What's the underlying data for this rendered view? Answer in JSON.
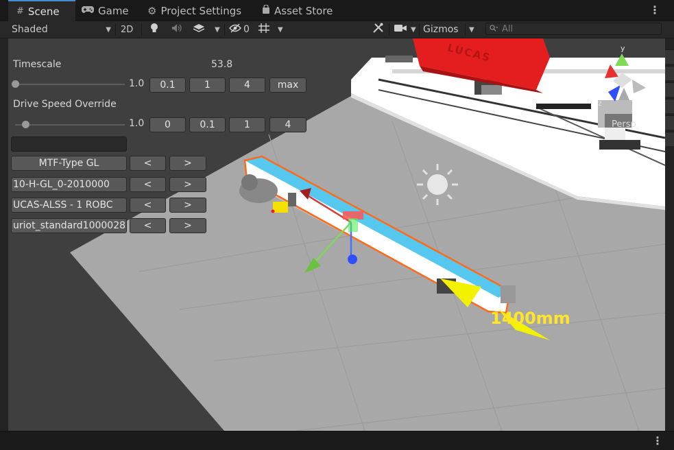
{
  "tabs": [
    {
      "icon": "#",
      "label": "Scene"
    },
    {
      "icon": "🎮",
      "label": "Game"
    },
    {
      "icon": "⚙",
      "label": "Project Settings"
    },
    {
      "icon": "🔒",
      "label": "Asset Store"
    }
  ],
  "toolbar": {
    "shading_mode": "Shaded",
    "mode_2d": "2D",
    "hidden_count": "0",
    "gizmos_label": "Gizmos",
    "search_placeholder": "All"
  },
  "overlay": {
    "timescale_label": "Timescale",
    "timescale_value": "53.8",
    "timescale_slider_value": "1.0",
    "timescale_presets": [
      "0.1",
      "1",
      "4",
      "max"
    ],
    "drive_speed_label": "Drive Speed Override",
    "drive_speed_slider_value": "1.0",
    "drive_speed_presets": [
      "0",
      "0.1",
      "1",
      "4"
    ],
    "selectors": [
      {
        "label": "MTF-Type GL",
        "prev": "<",
        "next": ">"
      },
      {
        "label": "10-H-GL_0-2010000",
        "prev": "<",
        "next": ">"
      },
      {
        "label": "UCAS-ALSS - 1 ROBC",
        "prev": "<",
        "next": ">"
      },
      {
        "label": "uriot_standard1000028",
        "prev": "<",
        "next": ">"
      }
    ]
  },
  "scene": {
    "machine_label": "LUCAS",
    "projection_label": "Persp",
    "axis_y": "y",
    "axis_z": "z",
    "dimension_label": "1400mm"
  },
  "colors": {
    "accent": "#4a8bd6",
    "conveyor_belt": "#56c8ef",
    "selection_outline": "#ff6a1a",
    "dimension_text": "#ffe52a",
    "machine_red": "#e41e1e"
  }
}
